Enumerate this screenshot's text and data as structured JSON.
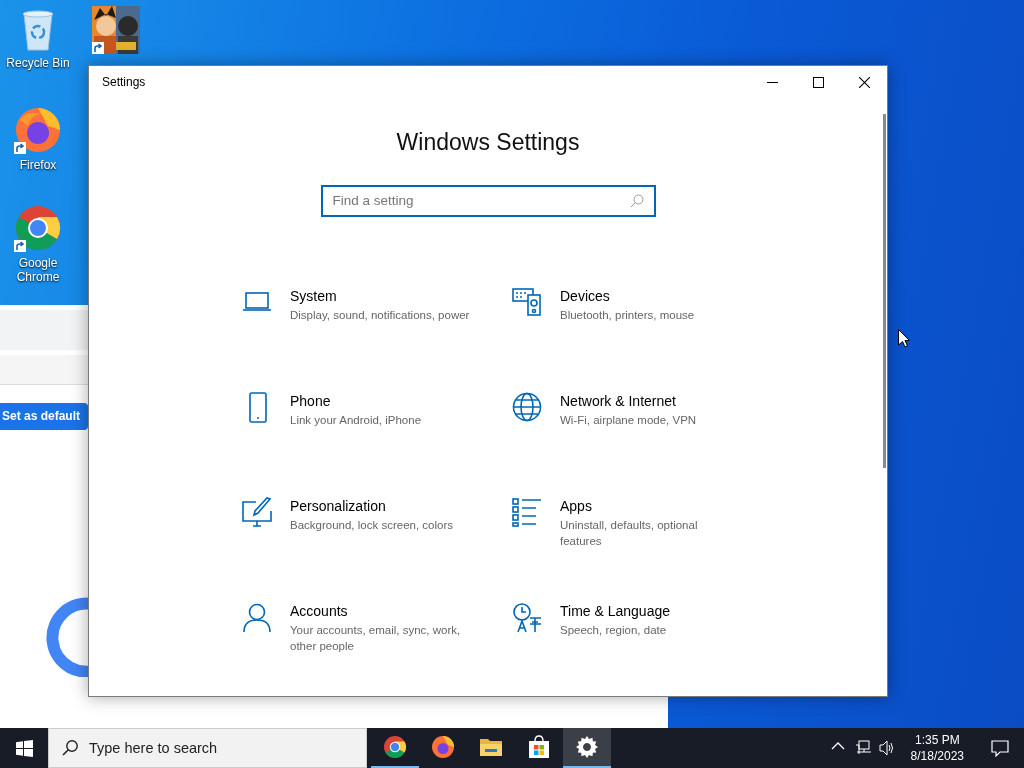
{
  "desktop_icons": [
    {
      "label": "Recycle Bin",
      "kind": "recycle",
      "shortcut": false
    },
    {
      "kind": "game",
      "shortcut": true
    },
    {
      "label": "Firefox",
      "kind": "firefox",
      "shortcut": true
    },
    {
      "label": "Google Chrome",
      "kind": "chrome",
      "shortcut": true
    }
  ],
  "background_window": {
    "button": "Set as default"
  },
  "settings_window": {
    "title": "Settings",
    "heading": "Windows Settings",
    "search": {
      "placeholder": "Find a setting"
    },
    "categories": [
      {
        "kind": "system",
        "title": "System",
        "description": "Display, sound, notifications, power"
      },
      {
        "kind": "devices",
        "title": "Devices",
        "description": "Bluetooth, printers, mouse"
      },
      {
        "kind": "phone",
        "title": "Phone",
        "description": "Link your Android, iPhone"
      },
      {
        "kind": "network",
        "title": "Network & Internet",
        "description": "Wi-Fi, airplane mode, VPN"
      },
      {
        "kind": "personalization",
        "title": "Personalization",
        "description": "Background, lock screen, colors"
      },
      {
        "kind": "apps",
        "title": "Apps",
        "description": "Uninstall, defaults, optional features"
      },
      {
        "kind": "accounts",
        "title": "Accounts",
        "description": "Your accounts, email, sync, work, other people"
      },
      {
        "kind": "time",
        "title": "Time & Language",
        "description": "Speech, region, date"
      }
    ]
  },
  "taskbar": {
    "search": {
      "placeholder": "Type here to search"
    },
    "apps": [
      {
        "kind": "chrome",
        "running": true,
        "selected": false
      },
      {
        "kind": "firefox",
        "running": false,
        "selected": false
      },
      {
        "kind": "explorer",
        "running": false,
        "selected": false
      },
      {
        "kind": "store",
        "running": false,
        "selected": false
      },
      {
        "kind": "settings",
        "running": true,
        "selected": true
      }
    ],
    "time": "1:35 PM",
    "date": "8/18/2023"
  }
}
